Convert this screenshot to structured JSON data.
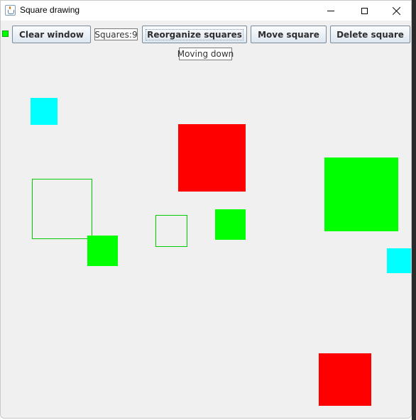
{
  "window": {
    "title": "Square drawing",
    "app_icon": "java-cup-icon"
  },
  "controls": {
    "minimize_icon": "minimize-icon",
    "maximize_icon": "maximize-icon",
    "close_icon": "close-icon"
  },
  "toolbar": {
    "current_color": "#00ff00",
    "clear_label": "Clear window",
    "squares_count": "Squares:9",
    "reorganize_label": "Reorganize squares",
    "move_label": "Move square",
    "delete_label": "Delete square"
  },
  "status": {
    "text": "Moving down"
  },
  "palette": {
    "red": "#ff0000",
    "green": "#00ff00",
    "cyan": "#00ffff",
    "outline_green": "#00cc00",
    "window_bg": "#f0f0f0"
  },
  "squares": [
    {
      "color": "cyan",
      "filled": true
    },
    {
      "color": "red",
      "filled": true
    },
    {
      "color": "green",
      "filled": true
    },
    {
      "color": "green",
      "filled": false
    },
    {
      "color": "green",
      "filled": true
    },
    {
      "color": "green",
      "filled": false
    },
    {
      "color": "green",
      "filled": true
    },
    {
      "color": "cyan",
      "filled": true
    },
    {
      "color": "red",
      "filled": true
    }
  ]
}
